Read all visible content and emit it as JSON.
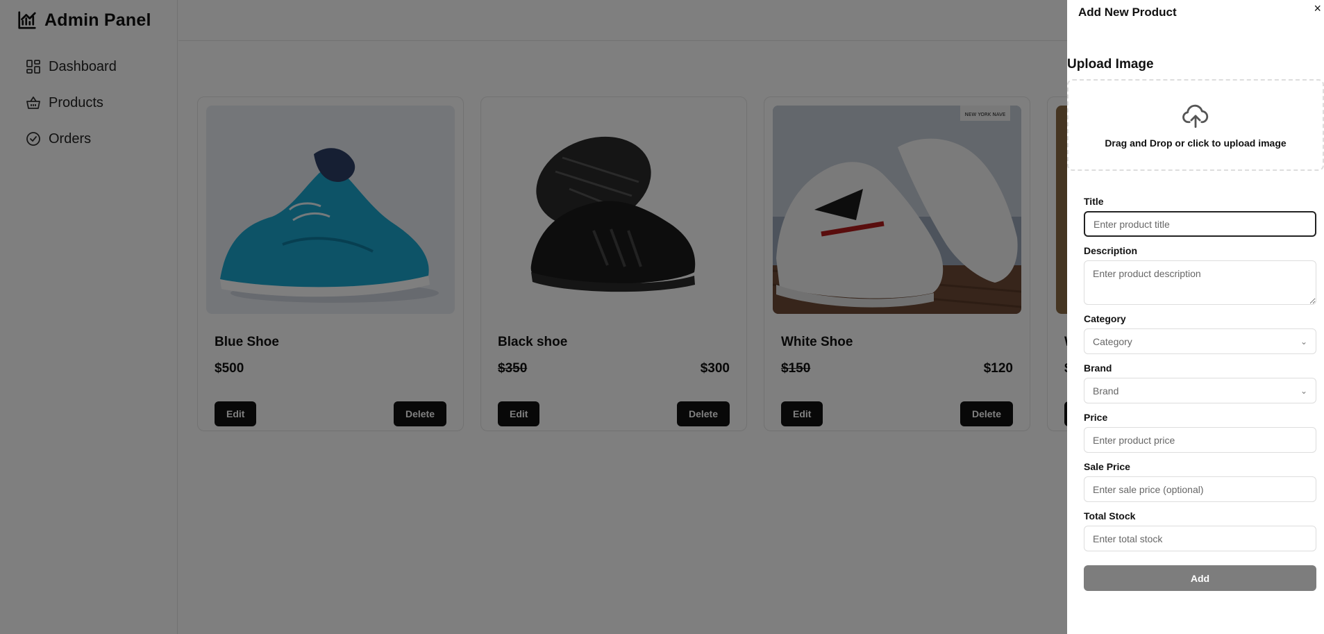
{
  "app": {
    "title": "Admin Panel",
    "logo_icon": "chart-line-icon"
  },
  "sidebar": {
    "items": [
      {
        "label": "Dashboard",
        "icon": "dashboard-grid-icon"
      },
      {
        "label": "Products",
        "icon": "basket-icon"
      },
      {
        "label": "Orders",
        "icon": "badge-check-icon"
      }
    ]
  },
  "products": [
    {
      "title": "Blue Shoe",
      "price": "$500",
      "sale_price": "",
      "edit_label": "Edit",
      "delete_label": "Delete",
      "image": "blue-running-shoes"
    },
    {
      "title": "Black shoe",
      "price": "$350",
      "sale_price": "$300",
      "edit_label": "Edit",
      "delete_label": "Delete",
      "image": "black-sneakers"
    },
    {
      "title": "White Shoe",
      "price": "$150",
      "sale_price": "$120",
      "edit_label": "Edit",
      "delete_label": "Delete",
      "image": "white-sneakers",
      "image_watermark": "NEW YORK NAVE"
    },
    {
      "title": "W",
      "price": "$",
      "sale_price": "",
      "edit_label": "E",
      "delete_label": "",
      "image": "partial-card"
    }
  ],
  "drawer": {
    "title": "Add New Product",
    "close_label": "×",
    "upload": {
      "label": "Upload Image",
      "text": "Drag and Drop or click to upload image",
      "icon": "cloud-upload-icon"
    },
    "fields": {
      "title": {
        "label": "Title",
        "placeholder": "Enter product title"
      },
      "description": {
        "label": "Description",
        "placeholder": "Enter product description"
      },
      "category": {
        "label": "Category",
        "value": "Category"
      },
      "brand": {
        "label": "Brand",
        "value": "Brand"
      },
      "price": {
        "label": "Price",
        "placeholder": "Enter product price"
      },
      "sale_price": {
        "label": "Sale Price",
        "placeholder": "Enter sale price (optional)"
      },
      "total_stock": {
        "label": "Total Stock",
        "placeholder": "Enter total stock"
      }
    },
    "submit_label": "Add"
  },
  "colors": {
    "overlay": "#000000",
    "button_dark": "#111111",
    "submit_disabled": "#7d7d7d",
    "border": "#e4e4e4"
  }
}
